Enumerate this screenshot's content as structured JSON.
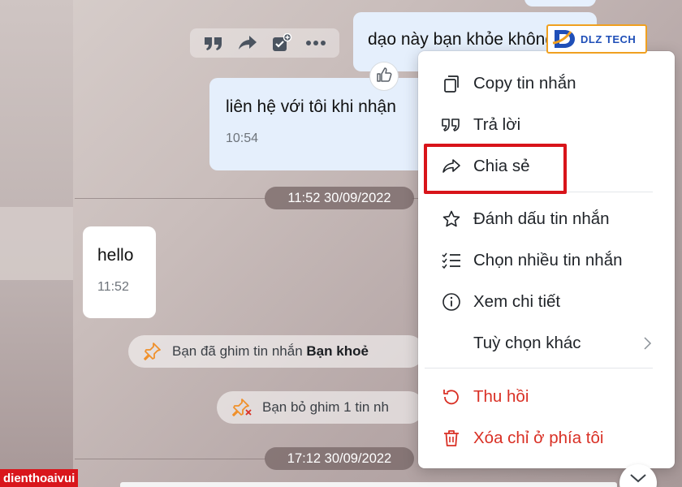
{
  "messages": [
    {
      "id": "msg-1",
      "side": "mine",
      "text": "dạo này bạn khỏe không"
    },
    {
      "id": "msg-2",
      "side": "mine",
      "text": "liên hệ với tôi khi nhận",
      "time": "10:54"
    },
    {
      "id": "msg-3",
      "side": "theirs",
      "text": "hello",
      "time": "11:52"
    }
  ],
  "timestamps": {
    "first": "11:52 30/09/2022",
    "second": "17:12 30/09/2022"
  },
  "notices": {
    "pinned_prefix": "Bạn đã ghim tin nhắn ",
    "pinned_bold": "Bạn khoẻ",
    "unpinned": "Bạn bỏ ghim 1 tin nh"
  },
  "action_bar": {
    "icons": [
      "quote-icon",
      "forward-icon",
      "add-task-icon",
      "more-icon"
    ]
  },
  "context_menu": {
    "copy": "Copy tin nhắn",
    "reply": "Trả lời",
    "share": "Chia sẻ",
    "mark": "Đánh dấu tin nhắn",
    "select_multiple": "Chọn nhiều tin nhắn",
    "details": "Xem chi tiết",
    "more_options": "Tuỳ chọn khác",
    "recall": "Thu hồi",
    "delete_for_me": "Xóa chỉ ở phía tôi"
  },
  "watermarks": {
    "dlz": "DLZ TECH",
    "dtv": "dienthoaivui"
  },
  "colors": {
    "highlight": "#d8141a",
    "danger": "#d93025",
    "mine_bubble": "#e5effc",
    "pin_icon": "#f0902a"
  }
}
